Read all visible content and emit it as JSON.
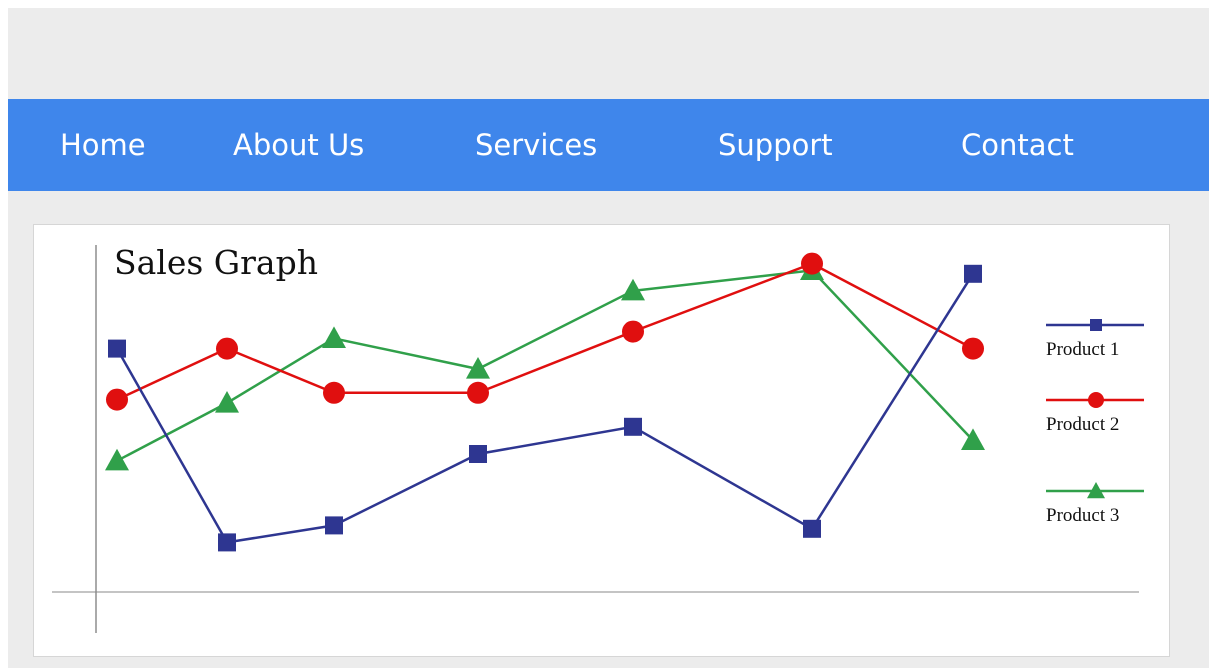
{
  "nav": {
    "items": [
      {
        "label": "Home"
      },
      {
        "label": "About Us"
      },
      {
        "label": "Services"
      },
      {
        "label": "Support"
      },
      {
        "label": "Contact"
      }
    ],
    "color": "#3f86eb"
  },
  "chart_data": {
    "type": "line",
    "title": "Sales Graph",
    "xlabel": "",
    "ylabel": "",
    "grid": false,
    "legend_position": "right",
    "x": [
      1,
      2,
      3,
      4,
      5,
      6,
      7
    ],
    "ylim": [
      0,
      100
    ],
    "series": [
      {
        "name": "Product 1",
        "color": "#2e3691",
        "marker": "square",
        "values": [
          71,
          14,
          19,
          40,
          48,
          18,
          93
        ]
      },
      {
        "name": "Product 2",
        "color": "#e00f0f",
        "marker": "circle",
        "values": [
          56,
          71,
          58,
          58,
          76,
          96,
          71
        ]
      },
      {
        "name": "Product 3",
        "color": "#30a04a",
        "marker": "triangle",
        "values": [
          38,
          55,
          74,
          65,
          88,
          94,
          44
        ]
      }
    ]
  }
}
